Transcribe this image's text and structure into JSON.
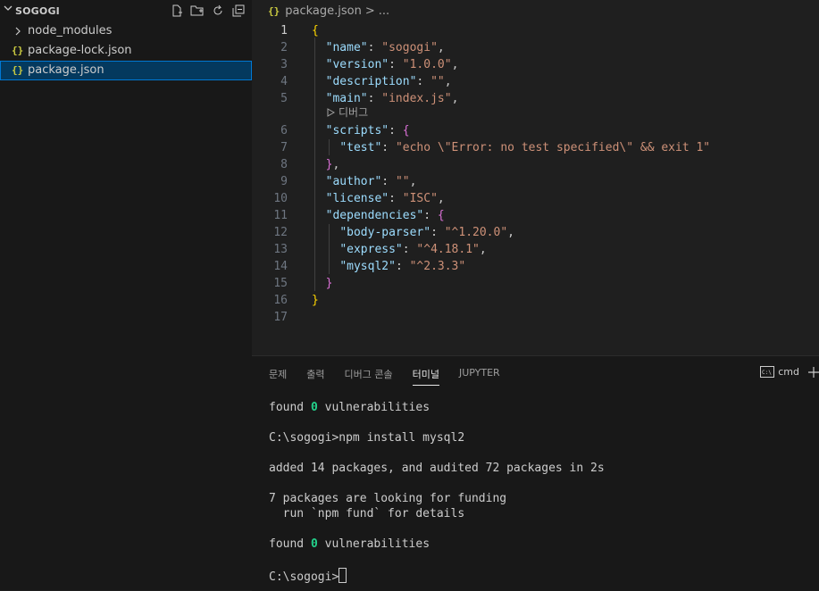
{
  "explorer": {
    "title": "SOGOGI",
    "actions": [
      "new-file-icon",
      "new-folder-icon",
      "refresh-icon",
      "collapse-all-icon"
    ],
    "items": [
      {
        "label": "node_modules",
        "type": "folder"
      },
      {
        "label": "package-lock.json",
        "type": "json",
        "icon": "{}"
      },
      {
        "label": "package.json",
        "type": "json",
        "icon": "{}",
        "selected": true
      }
    ]
  },
  "editor": {
    "breadcrumb": {
      "icon": "{}",
      "file": "package.json",
      "separator": ">",
      "rest": "..."
    },
    "codelens": "디버그",
    "line_numbers": [
      "1",
      "2",
      "3",
      "4",
      "5",
      "6",
      "7",
      "8",
      "9",
      "10",
      "11",
      "12",
      "13",
      "14",
      "15",
      "16",
      "17"
    ],
    "lines": [
      "{",
      "  \"name\": \"sogogi\",",
      "  \"version\": \"1.0.0\",",
      "  \"description\": \"\",",
      "  \"main\": \"index.js\",",
      "  \"scripts\": {",
      "    \"test\": \"echo \\\"Error: no test specified\\\" && exit 1\"",
      "  },",
      "  \"author\": \"\",",
      "  \"license\": \"ISC\",",
      "  \"dependencies\": {",
      "    \"body-parser\": \"^1.20.0\",",
      "    \"express\": \"^4.18.1\",",
      "    \"mysql2\": \"^2.3.3\"",
      "  }",
      "}",
      ""
    ]
  },
  "panel": {
    "tabs": [
      "문제",
      "출력",
      "디버그 콘솔",
      "터미널",
      "JUPYTER"
    ],
    "active_tab": "터미널",
    "shell": "cmd",
    "terminal": {
      "line1_a": "found ",
      "line1_zero": "0",
      "line1_b": " vulnerabilities",
      "line2": "C:\\sogogi>npm install mysql2",
      "line3": "added 14 packages, and audited 72 packages in 2s",
      "line4": "7 packages are looking for funding",
      "line5": "  run `npm fund` for details",
      "line6_a": "found ",
      "line6_zero": "0",
      "line6_b": " vulnerabilities",
      "prompt": "C:\\sogogi>"
    }
  },
  "colors": {
    "key": "#9cdcfe",
    "string": "#ce9178",
    "brace1": "#ffd700",
    "brace2": "#da70d6",
    "json_icon": "#cbcb41",
    "success": "#23d18b",
    "selection": "#04395e"
  }
}
